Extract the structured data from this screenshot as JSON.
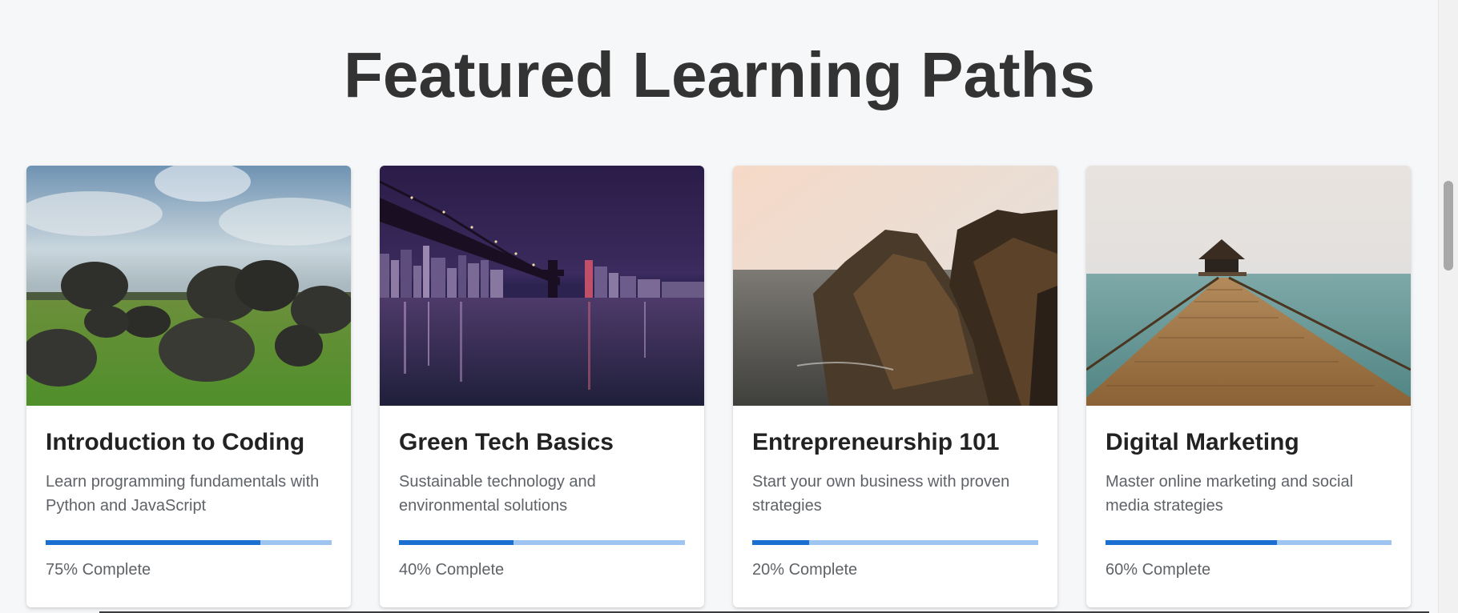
{
  "section": {
    "title": "Featured Learning Paths"
  },
  "colors": {
    "progress_fill": "#1a6fd1",
    "progress_track": "#9ec5ef",
    "page_background": "#f6f7f9"
  },
  "cards": [
    {
      "title": "Introduction to Coding",
      "description": "Learn programming fundamentals with Python and JavaScript",
      "progress_percent": 75,
      "progress_label": "75% Complete",
      "image_alt": "Boulders on green grass under a cloudy sky"
    },
    {
      "title": "Green Tech Basics",
      "description": "Sustainable technology and environmental solutions",
      "progress_percent": 40,
      "progress_label": "40% Complete",
      "image_alt": "Bridge over water with a city skyline at night"
    },
    {
      "title": "Entrepreneurship 101",
      "description": "Start your own business with proven strategies",
      "progress_percent": 20,
      "progress_label": "20% Complete",
      "image_alt": "Rocky coastal cliffs at sunset"
    },
    {
      "title": "Digital Marketing",
      "description": "Master online marketing and social media strategies",
      "progress_percent": 60,
      "progress_label": "60% Complete",
      "image_alt": "Wooden pier leading to a gazebo over the sea"
    }
  ]
}
